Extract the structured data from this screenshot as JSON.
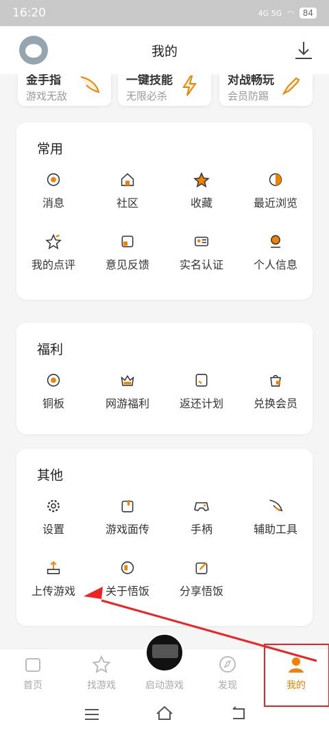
{
  "status": {
    "time": "16:20",
    "network": "4G 5G",
    "battery": "84"
  },
  "header": {
    "title": "我的"
  },
  "top_cards": [
    {
      "title": "金手指",
      "subtitle": "游戏无敌"
    },
    {
      "title": "一键技能",
      "subtitle": "无限必杀"
    },
    {
      "title": "对战畅玩",
      "subtitle": "会员防踢"
    }
  ],
  "sections": [
    {
      "title": "常用",
      "items": [
        "消息",
        "社区",
        "收藏",
        "最近浏览",
        "我的点评",
        "意见反馈",
        "实名认证",
        "个人信息"
      ]
    },
    {
      "title": "福利",
      "items": [
        "铜板",
        "网游福利",
        "返还计划",
        "兑换会员"
      ]
    },
    {
      "title": "其他",
      "items": [
        "设置",
        "游戏面传",
        "手柄",
        "辅助工具",
        "上传游戏",
        "关于悟饭",
        "分享悟饭"
      ]
    }
  ],
  "bottom_nav": [
    {
      "label": "首页"
    },
    {
      "label": "找游戏"
    },
    {
      "label": "启动游戏"
    },
    {
      "label": "发现"
    },
    {
      "label": "我的"
    }
  ],
  "colors": {
    "accent": "#f08200",
    "annotation": "#e22222"
  }
}
